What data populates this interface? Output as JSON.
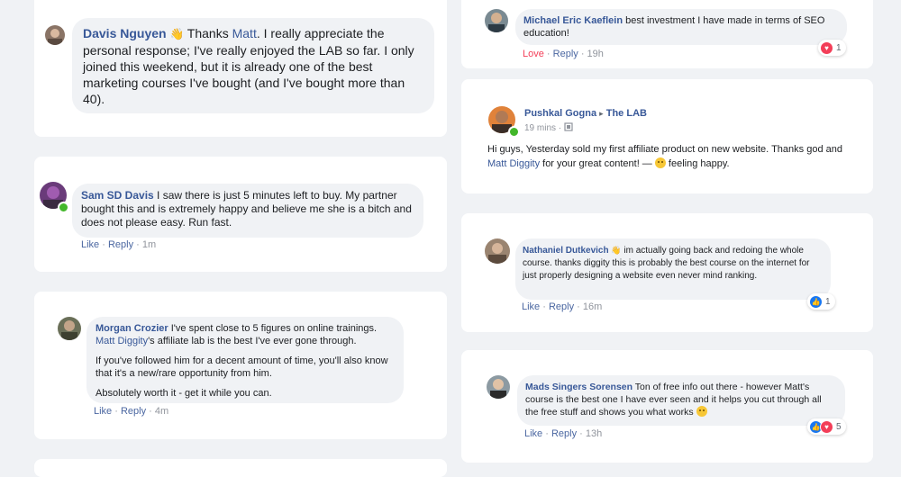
{
  "comments": {
    "davis": {
      "name": "Davis Nguyen",
      "t1": " Thanks ",
      "mention": "Matt",
      "t2": ". I really appreciate the personal response; I've really enjoyed the LAB so far. I only joined this weekend, but it is already one of the best marketing courses I've bought (and I've bought more than 40)."
    },
    "sam": {
      "name": "Sam SD Davis",
      "text": " I saw there is just 5 minutes left to buy. My partner bought this and is extremely happy and believe me she is a bitch and does not please easy. Run fast.",
      "like": "Like",
      "reply": "Reply",
      "time": "1m"
    },
    "morgan": {
      "name": "Morgan Crozier",
      "t1": " I've spent close to 5 figures on online trainings. ",
      "mention": "Matt Diggity",
      "t2": "'s affiliate lab is the best I've ever gone through.",
      "p2": "If you've followed him for a decent amount of time, you'll also know that it's a new/rare opportunity from him.",
      "p3": "Absolutely worth it - get it while you can.",
      "like": "Like",
      "reply": "Reply",
      "time": "4m"
    },
    "michael": {
      "name": "Michael Eric Kaeflein",
      "text": " best investment I have made in terms of SEO education!",
      "love": "Love",
      "reply": "Reply",
      "time": "19h",
      "reaction_count": "1"
    },
    "pushkal": {
      "name": "Pushkal Gogna",
      "group": "The LAB",
      "time": "19 mins",
      "t1": "Hi guys, Yesterday sold my first affiliate product on new website. Thanks god and ",
      "mention": "Matt Diggity",
      "t2": " for your great content! — ",
      "feeling": " feeling happy."
    },
    "nathaniel": {
      "name": "Nathaniel Dutkevich",
      "text": " im actually going back and redoing the whole course. thanks diggity this is probably the best course on the internet for just properly designing a website even never mind ranking.",
      "like": "Like",
      "reply": "Reply",
      "time": "16m",
      "reaction_count": "1"
    },
    "mads": {
      "name": "Mads Singers Sorensen",
      "text": " Ton of free info out there - however Matt's course is the best one I have ever seen and it helps you cut through all the free stuff and shows you what works ",
      "like": "Like",
      "reply": "Reply",
      "time": "13h",
      "reaction_count": "5"
    }
  },
  "symbols": {
    "wave": "👋",
    "sep": " · ",
    "caret": "▸"
  },
  "colors": {
    "name_link": "#385898",
    "action": "#4b67a1",
    "love": "#f33e58",
    "like_blue": "#1877f2",
    "online": "#42b72a",
    "bg": "#f0f2f5"
  },
  "icons": [
    "avatar",
    "online-dot-icon",
    "wave-icon",
    "heart-icon",
    "like-icon",
    "smile-emoji-icon",
    "caret-right-icon",
    "globe-icon"
  ]
}
